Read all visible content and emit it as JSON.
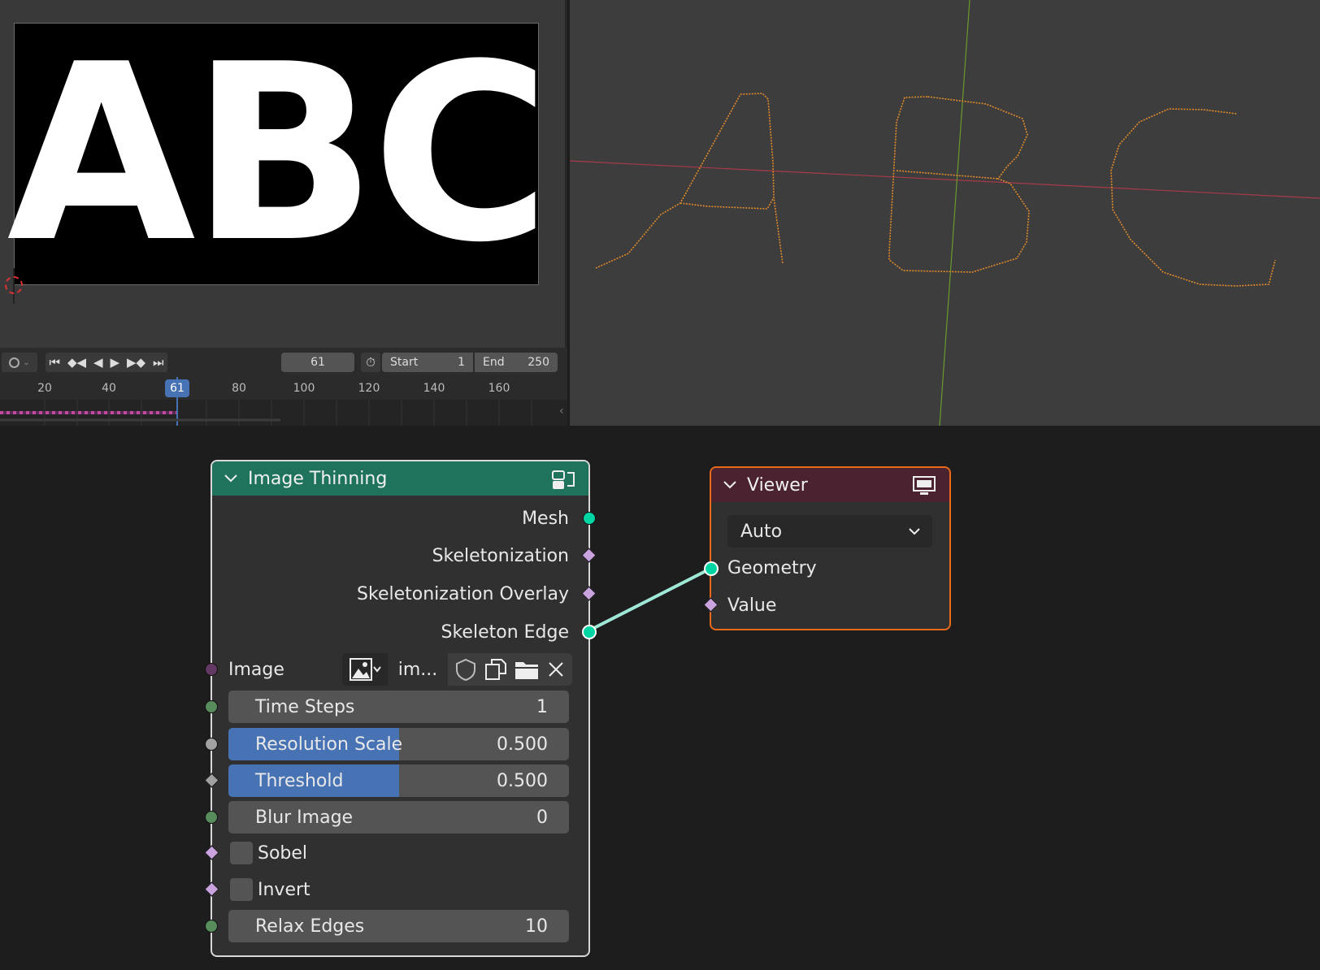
{
  "image_editor": {
    "canvas_text": "ABC"
  },
  "timeline": {
    "current_frame": "61",
    "start_label": "Start",
    "start_value": "1",
    "end_label": "End",
    "end_value": "250",
    "ruler_ticks": [
      "20",
      "40",
      "61",
      "80",
      "100",
      "120",
      "140",
      "160"
    ],
    "frame_badge": "61"
  },
  "viewport": {
    "curve_color": "#e08a2c",
    "x_axis_color": "#a83a4a",
    "y_axis_color": "#6a9a2a"
  },
  "nodes": {
    "image_thinning": {
      "title": "Image Thinning",
      "header_color": "#1f735c",
      "outputs": [
        "Mesh",
        "Skeletonization",
        "Skeletonization Overlay",
        "Skeleton Edge"
      ],
      "image_label": "Image",
      "image_name": "im...",
      "time_steps": {
        "label": "Time Steps",
        "value": "1"
      },
      "resolution_scale": {
        "label": "Resolution Scale",
        "value": "0.500",
        "fraction": 0.5
      },
      "threshold": {
        "label": "Threshold",
        "value": "0.500",
        "fraction": 0.5
      },
      "blur_image": {
        "label": "Blur Image",
        "value": "0"
      },
      "sobel": {
        "label": "Sobel",
        "checked": false
      },
      "invert": {
        "label": "Invert",
        "checked": false
      },
      "relax_edges": {
        "label": "Relax Edges",
        "value": "10"
      }
    },
    "viewer": {
      "title": "Viewer",
      "header_color": "#4a2230",
      "dropdown_value": "Auto",
      "inputs": [
        "Geometry",
        "Value"
      ]
    }
  }
}
